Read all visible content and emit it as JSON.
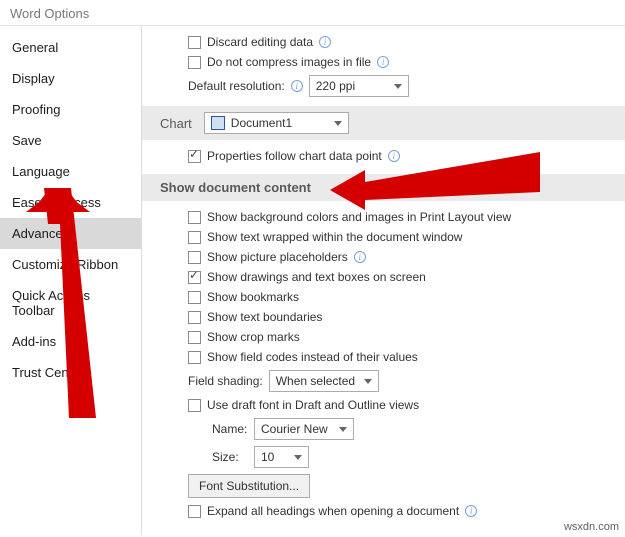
{
  "window": {
    "title": "Word Options"
  },
  "sidebar": {
    "items": [
      {
        "label": "General"
      },
      {
        "label": "Display"
      },
      {
        "label": "Proofing"
      },
      {
        "label": "Save"
      },
      {
        "label": "Language"
      },
      {
        "label": "Ease of Access"
      },
      {
        "label": "Advanced",
        "selected": true
      },
      {
        "label": "Customize Ribbon"
      },
      {
        "label": "Quick Access Toolbar"
      },
      {
        "label": "Add-ins"
      },
      {
        "label": "Trust Center"
      }
    ]
  },
  "main": {
    "discard": "Discard editing data",
    "noCompress": "Do not compress images in file",
    "defaultResLabel": "Default resolution:",
    "defaultResValue": "220 ppi",
    "chart": {
      "heading": "Chart",
      "docName": "Document1",
      "propFollow": "Properties follow chart data point"
    },
    "showContent": {
      "heading": "Show document content",
      "bg": "Show background colors and images in Print Layout view",
      "wrap": "Show text wrapped within the document window",
      "picPl": "Show picture placeholders",
      "draw": "Show drawings and text boxes on screen",
      "bkm": "Show bookmarks",
      "tb": "Show text boundaries",
      "crop": "Show crop marks",
      "fc": "Show field codes instead of their values",
      "fsLabel": "Field shading:",
      "fsValue": "When selected",
      "draft": "Use draft font in Draft and Outline views",
      "nameLabel": "Name:",
      "nameValue": "Courier New",
      "sizeLabel": "Size:",
      "sizeValue": "10",
      "fontSub": "Font Substitution...",
      "expand": "Expand all headings when opening a document"
    }
  },
  "watermark": "wsxdn.com"
}
